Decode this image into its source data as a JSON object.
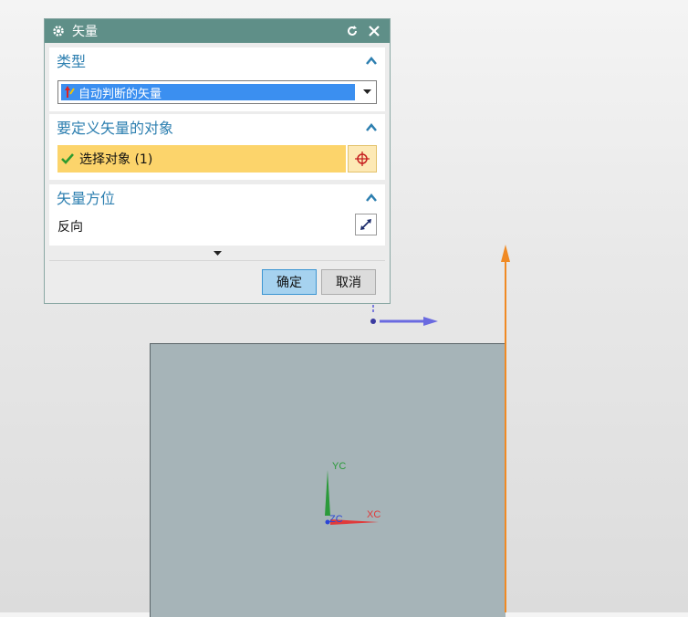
{
  "dialog": {
    "title": "矢量",
    "groups": {
      "type": {
        "heading": "类型",
        "selected": "自动判断的矢量"
      },
      "object": {
        "heading": "要定义矢量的对象",
        "select_label": "选择对象 (1)"
      },
      "orientation": {
        "heading": "矢量方位",
        "reverse_label": "反向"
      }
    },
    "buttons": {
      "ok": "确定",
      "cancel": "取消"
    }
  },
  "viewport": {
    "triad": {
      "x_label": "XC",
      "y_label": "YC",
      "z_label": "ZC"
    },
    "colors": {
      "plane": "#a6b4b8",
      "vector_arrow": "#f08a24",
      "x_axis": "#e03a3a",
      "y_axis": "#2b9a3a",
      "z_axis": "#2a45d6"
    }
  },
  "icons": [
    "gear-icon",
    "reset-icon",
    "close-icon",
    "chevron-up-icon",
    "vector-type-icon",
    "dropdown-arrow-icon",
    "check-icon",
    "crosshair-icon",
    "reverse-direction-icon",
    "more-options-icon"
  ]
}
